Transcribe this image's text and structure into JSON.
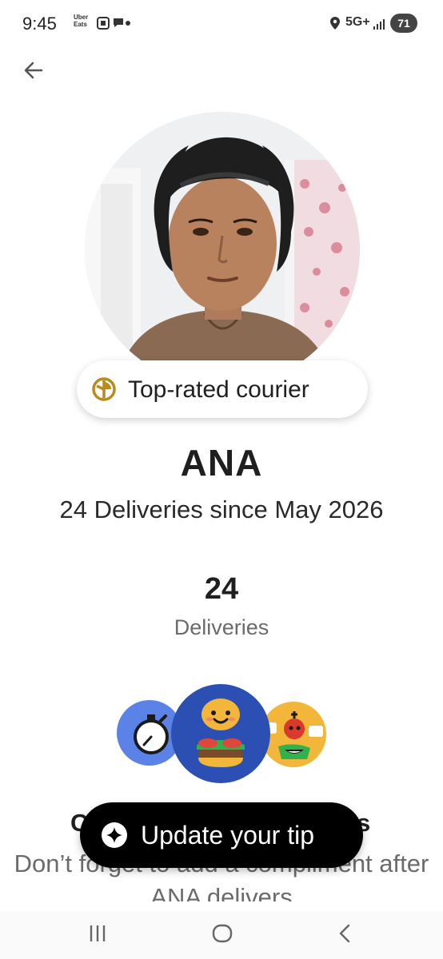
{
  "status_bar": {
    "time": "9:45",
    "app_badge": "Uber Eats",
    "network": "5G+",
    "battery": "71"
  },
  "profile": {
    "badge_label": "Top-rated courier",
    "badge_icon": "top-rated-medal-icon",
    "name": "ANA",
    "since": "24 Deliveries since May 2026"
  },
  "stats": {
    "value": "24",
    "label": "Deliveries"
  },
  "compliment": {
    "title_visible_start": "C",
    "title_visible_end": "s",
    "description": "Don’t forget to add a compliment after ANA delivers"
  },
  "cta": {
    "label": "Update your tip",
    "icon": "sparkle-icon"
  },
  "colors": {
    "accent_blue": "#2b4fb3",
    "illus_blue_light": "#5b82e6",
    "illus_yellow": "#f2b63a",
    "badge_gold": "#b98a1e",
    "button_black": "#000000"
  }
}
